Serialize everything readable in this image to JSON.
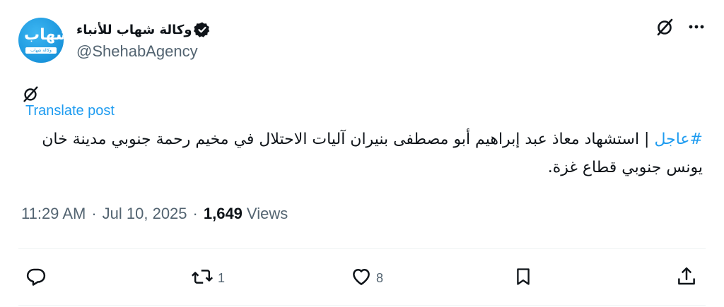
{
  "author": {
    "display_name": "وكالة شهاب للأنباء",
    "handle": "@ShehabAgency",
    "avatar_glyph": "شهاب",
    "avatar_band_text": "وكالة شهاب للأنباء",
    "verified": true
  },
  "translate": {
    "label": "Translate post"
  },
  "tweet": {
    "hashtag": "#عاجل",
    "body": " | استشهاد معاذ عبد إبراهيم أبو مصطفى بنيران آليات الاحتلال في مخيم رحمة جنوبي مدينة خان يونس جنوبي قطاع غزة."
  },
  "meta": {
    "time": "11:29 AM",
    "separator": "·",
    "date": "Jul 10, 2025",
    "views_count": "1,649",
    "views_label": "Views"
  },
  "actions": {
    "reply_count": "",
    "repost_count": "1",
    "like_count": "8"
  },
  "colors": {
    "accent": "#1d9bf0",
    "text": "#0f1419",
    "muted": "#536471",
    "divider": "#eff3f4"
  },
  "icons": {
    "header_left": "grok-icon",
    "more": "more-options-icon",
    "inline": "grok-icon",
    "reply": "reply-icon",
    "repost": "repost-icon",
    "like": "like-icon",
    "bookmark": "bookmark-icon",
    "share": "share-icon"
  }
}
